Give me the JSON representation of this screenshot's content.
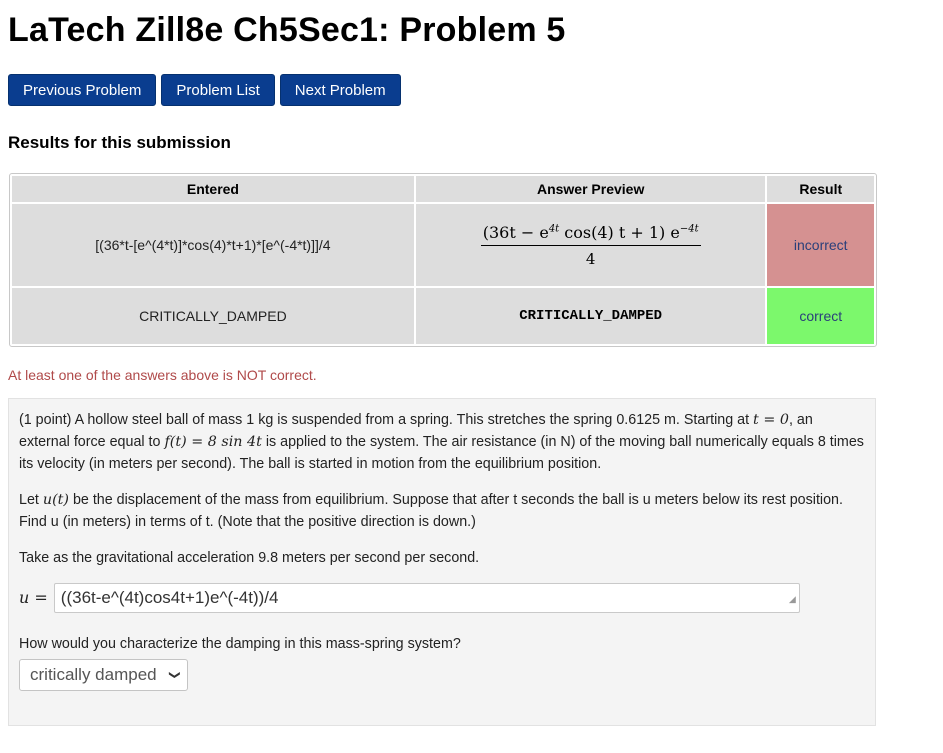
{
  "page": {
    "title": "LaTech Zill8e Ch5Sec1: Problem 5"
  },
  "nav": {
    "prev": "Previous Problem",
    "list": "Problem List",
    "next": "Next Problem"
  },
  "results": {
    "heading": "Results for this submission",
    "headers": {
      "entered": "Entered",
      "preview": "Answer Preview",
      "result": "Result"
    },
    "rows": [
      {
        "entered": "[(36*t-[e^(4*t)]*cos(4)*t+1)*[e^(-4*t)]]/4",
        "preview_numerator": "(36t − e",
        "preview_exp1": "4t",
        "preview_mid": " cos(4) t + 1) e",
        "preview_exp2": "−4t",
        "preview_denominator": "4",
        "result": "incorrect"
      },
      {
        "entered": "CRITICALLY_DAMPED",
        "preview": "CRITICALLY_DAMPED",
        "result": "correct"
      }
    ],
    "warning": "At least one of the answers above is NOT correct."
  },
  "problem": {
    "p1_a": "(1 point) A hollow steel ball of mass 1 kg is suspended from a spring. This stretches the spring 0.6125 m. Starting at ",
    "p1_t0": "t = 0",
    "p1_b": ", an external force equal to ",
    "p1_force": "f(t) = 8 sin 4t",
    "p1_c": " is applied to the system. The air resistance (in N) of the moving ball numerically equals 8 times its velocity (in meters per second). The ball is started in motion from the equilibrium position.",
    "p2_a": "Let ",
    "p2_u": "u(t)",
    "p2_b": " be the displacement of the mass from equilibrium. Suppose that after t seconds the ball is u meters below its rest position. Find u (in meters) in terms of t. (Note that the positive direction is down.)",
    "p3": "Take as the gravitational acceleration 9.8 meters per second per second.",
    "answer_label": "u =",
    "answer_value": "((36t-e^(4t)cos4t+1)e^(-4t))/4",
    "q2": "How would you characterize the damping in this mass-spring system?",
    "select_value": "critically damped"
  },
  "colors": {
    "nav": "#0a3d8f",
    "incorrect": "#d59191",
    "correct": "#7cf86c",
    "warning": "#b04a4a"
  }
}
